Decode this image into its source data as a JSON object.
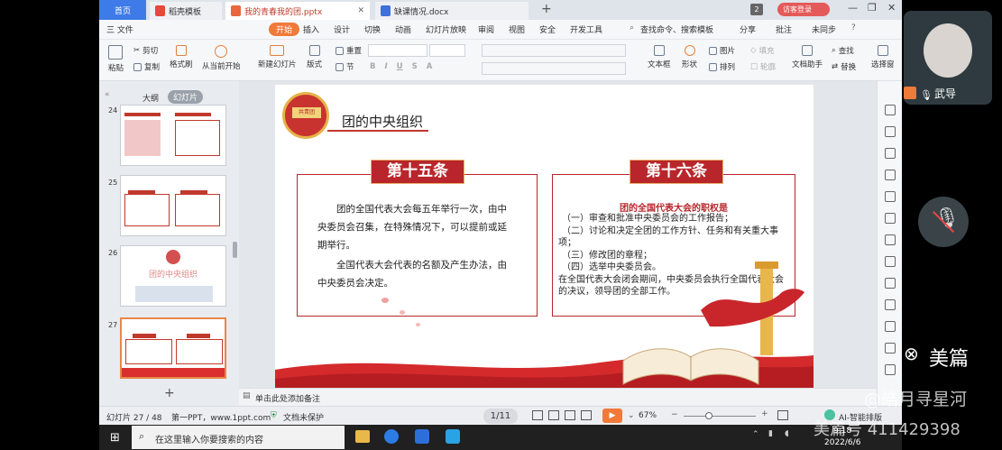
{
  "tabs": {
    "home": "首页",
    "template": "稻壳模板",
    "pptx": "我的青春我的团.pptx",
    "docx": "缺课情况.docx",
    "count": "2",
    "login": "访客登录"
  },
  "menu": {
    "file": "三 文件",
    "start": "开始",
    "items": [
      "插入",
      "设计",
      "切换",
      "动画",
      "幻灯片放映",
      "审阅",
      "视图",
      "安全",
      "开发工具"
    ],
    "search": "查找命令、搜索模板",
    "share": "分享",
    "comment": "批注",
    "sync": "未同步"
  },
  "ribbon": {
    "paste": "粘贴",
    "cut": "剪切",
    "copy": "复制",
    "format_painter": "格式刷",
    "play_from": "从当前开始",
    "new_slide": "新建幻灯片",
    "layout": "版式",
    "reset": "重置",
    "section": "节",
    "textbox": "文本框",
    "shape": "形状",
    "picture": "图片",
    "arrange": "排列",
    "fill": "填充",
    "outline": "轮廓",
    "doc_helper": "文档助手",
    "find": "查找",
    "replace": "替换",
    "select": "选择窗"
  },
  "sidepane": {
    "outline": "大纲",
    "slides": "幻灯片",
    "nums": [
      "24",
      "25",
      "26",
      "27"
    ],
    "thumb26_title": "团的中央组织"
  },
  "slide": {
    "header": "团的中央组织",
    "logo_text": "共青团",
    "left_title": "第十五条",
    "left_para1": "团的全国代表大会每五年举行一次，由中央委员会召集，在特殊情况下，可以提前或延期举行。",
    "left_para2": "全国代表大会代表的名额及产生办法，由中央委员会决定。",
    "right_title": "第十六条",
    "right_heading": "团的全国代表大会的职权是",
    "right_items": [
      "（一）审查和批准中央委员会的工作报告；",
      "（二）讨论和决定全团的工作方针、任务和有关重大事项；",
      "（三）修改团的章程；",
      "（四）选举中央委员会。"
    ],
    "right_tail": "在全国代表大会闭会期间，中央委员会执行全国代表大会的决议，领导团的全部工作。"
  },
  "notes": "单击此处添加备注",
  "status": {
    "slide_count": "幻灯片 27 / 48",
    "theme": "第一PPT，www.1ppt.com",
    "protect": "文档未保护",
    "page": "1/11",
    "zoom": "67%",
    "ai": "AI-智能排版"
  },
  "taskbar": {
    "search": "在这里输入你要搜索的内容",
    "time": "9:18",
    "date": "2022/6/6"
  },
  "overlay": {
    "user": "武导",
    "brand": "美篇",
    "watermark1": "@皓月寻星河",
    "watermark2": "美篇号 411429398"
  }
}
